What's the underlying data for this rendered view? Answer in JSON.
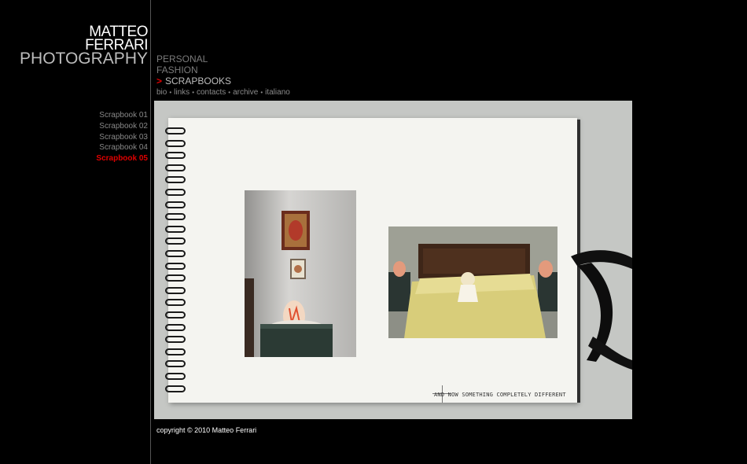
{
  "logo": {
    "line1": "MATTEO",
    "line2": "FERRARI",
    "line3": "PHOTOGRAPHY"
  },
  "main_menu": {
    "items": [
      "PERSONAL",
      "FASHION",
      "SCRAPBOOKS"
    ],
    "active_index": 2,
    "active_marker": ">"
  },
  "sub_menu": {
    "items": [
      "bio",
      "links",
      "contacts",
      "archive",
      "italiano"
    ],
    "separator": "•"
  },
  "scrapbook_nav": {
    "items": [
      "Scrapbook 01",
      "Scrapbook 02",
      "Scrapbook 03",
      "Scrapbook 04",
      "Scrapbook 05"
    ],
    "active_index": 4
  },
  "photo": {
    "caption": "AND NOW SOMETHING COMPLETELY DIFFERENT"
  },
  "footer": {
    "copyright": "copyright © 2010 Matteo Ferrari"
  },
  "colors": {
    "accent": "#e10000",
    "background": "#000000",
    "muted": "#888888"
  }
}
